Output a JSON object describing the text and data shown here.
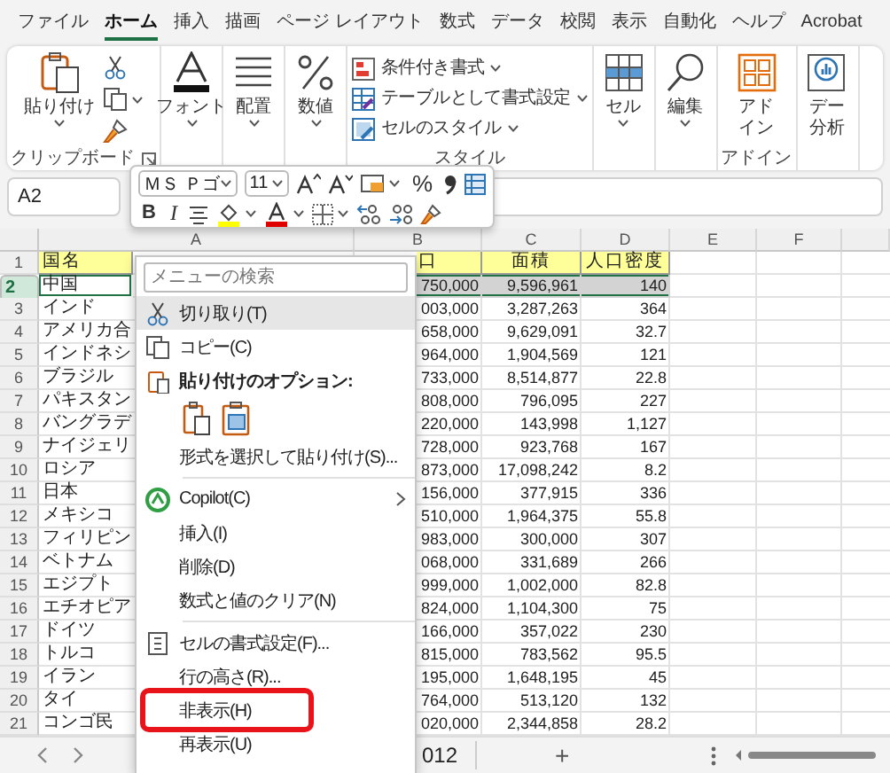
{
  "menu_tabs": [
    {
      "label": "ファイル",
      "selected": false
    },
    {
      "label": "ホーム",
      "selected": true
    },
    {
      "label": "挿入",
      "selected": false
    },
    {
      "label": "描画",
      "selected": false
    },
    {
      "label": "ページ レイアウト",
      "selected": false
    },
    {
      "label": "数式",
      "selected": false
    },
    {
      "label": "データ",
      "selected": false
    },
    {
      "label": "校閲",
      "selected": false
    },
    {
      "label": "表示",
      "selected": false
    },
    {
      "label": "自動化",
      "selected": false
    },
    {
      "label": "ヘルプ",
      "selected": false
    },
    {
      "label": "Acrobat",
      "selected": false
    }
  ],
  "ribbon_groups": [
    {
      "kind": "clipboard",
      "button": "貼り付け",
      "label": "クリップボード"
    },
    {
      "kind": "big",
      "button_lines": [
        "フォント"
      ],
      "dropdown": true
    },
    {
      "kind": "big",
      "button_lines": [
        "配置"
      ],
      "dropdown": true
    },
    {
      "kind": "big",
      "button_lines": [
        "数値"
      ],
      "dropdown": true
    },
    {
      "kind": "styles",
      "items": [
        "条件付き書式",
        "テーブルとして書式設定",
        "セルのスタイル"
      ],
      "label": "スタイル"
    },
    {
      "kind": "big",
      "button_lines": [
        "セル"
      ],
      "dropdown": true
    },
    {
      "kind": "big",
      "button_lines": [
        "編集"
      ],
      "dropdown": true
    },
    {
      "kind": "big",
      "button_lines": [
        "アド",
        "イン"
      ],
      "dropdown": false,
      "label": "アドイン"
    },
    {
      "kind": "big",
      "button_lines": [
        "デー",
        "分析"
      ],
      "dropdown": false
    }
  ],
  "formula_bar": {
    "name_box": "A2"
  },
  "mini_toolbar": {
    "font": "ＭＳ Ｐゴ",
    "size": "11",
    "percent": "%",
    "bold": "B",
    "italic": "I"
  },
  "sheet": {
    "columns": [
      "A",
      "B",
      "C",
      "D",
      "E",
      "F"
    ],
    "rows": [
      {
        "number": "1",
        "kind": "header",
        "selected": false,
        "cells": [
          "国名",
          "口",
          "面積",
          "人口密度"
        ]
      },
      {
        "number": "2",
        "kind": "data",
        "selected": true,
        "cells": [
          "中国",
          "750,000",
          "9,596,961",
          "140"
        ]
      },
      {
        "number": "3",
        "kind": "data",
        "selected": false,
        "cells": [
          "インド",
          "003,000",
          "3,287,263",
          "364"
        ]
      },
      {
        "number": "4",
        "kind": "data",
        "selected": false,
        "cells": [
          "アメリカ合",
          "658,000",
          "9,629,091",
          "32.7"
        ]
      },
      {
        "number": "5",
        "kind": "data",
        "selected": false,
        "cells": [
          "インドネシ",
          "964,000",
          "1,904,569",
          "121"
        ]
      },
      {
        "number": "6",
        "kind": "data",
        "selected": false,
        "cells": [
          "ブラジル",
          "733,000",
          "8,514,877",
          "22.8"
        ]
      },
      {
        "number": "7",
        "kind": "data",
        "selected": false,
        "cells": [
          "パキスタン",
          "808,000",
          "796,095",
          "227"
        ]
      },
      {
        "number": "8",
        "kind": "data",
        "selected": false,
        "cells": [
          "バングラデ",
          "220,000",
          "143,998",
          "1,127"
        ]
      },
      {
        "number": "9",
        "kind": "data",
        "selected": false,
        "cells": [
          "ナイジェリ",
          "728,000",
          "923,768",
          "167"
        ]
      },
      {
        "number": "10",
        "kind": "data",
        "selected": false,
        "cells": [
          "ロシア",
          "873,000",
          "17,098,242",
          "8.2"
        ]
      },
      {
        "number": "11",
        "kind": "data",
        "selected": false,
        "cells": [
          "日本",
          "156,000",
          "377,915",
          "336"
        ]
      },
      {
        "number": "12",
        "kind": "data",
        "selected": false,
        "cells": [
          "メキシコ",
          "510,000",
          "1,964,375",
          "55.8"
        ]
      },
      {
        "number": "13",
        "kind": "data",
        "selected": false,
        "cells": [
          "フィリピン",
          "983,000",
          "300,000",
          "307"
        ]
      },
      {
        "number": "14",
        "kind": "data",
        "selected": false,
        "cells": [
          "ベトナム",
          "068,000",
          "331,689",
          "266"
        ]
      },
      {
        "number": "15",
        "kind": "data",
        "selected": false,
        "cells": [
          "エジプト",
          "999,000",
          "1,002,000",
          "82.8"
        ]
      },
      {
        "number": "16",
        "kind": "data",
        "selected": false,
        "cells": [
          "エチオピア",
          "824,000",
          "1,104,300",
          "75"
        ]
      },
      {
        "number": "17",
        "kind": "data",
        "selected": false,
        "cells": [
          "ドイツ",
          "166,000",
          "357,022",
          "230"
        ]
      },
      {
        "number": "18",
        "kind": "data",
        "selected": false,
        "cells": [
          "トルコ",
          "815,000",
          "783,562",
          "95.5"
        ]
      },
      {
        "number": "19",
        "kind": "data",
        "selected": false,
        "cells": [
          "イラン",
          "195,000",
          "1,648,195",
          "45"
        ]
      },
      {
        "number": "20",
        "kind": "data",
        "selected": false,
        "cells": [
          "タイ",
          "764,000",
          "513,120",
          "132"
        ]
      },
      {
        "number": "21",
        "kind": "data",
        "selected": false,
        "cells": [
          "コンゴ民",
          "020,000",
          "2,344,858",
          "28.2"
        ]
      }
    ]
  },
  "sheet_bar": {
    "tab": "012",
    "add_button": "+"
  },
  "context_menu": {
    "search_placeholder": "メニューの検索",
    "items": [
      {
        "kind": "item",
        "label": "切り取り(T)",
        "selected": true,
        "boxed": false,
        "submenu": false
      },
      {
        "kind": "item",
        "label": "コピー(C)",
        "selected": false,
        "boxed": false,
        "submenu": false
      },
      {
        "kind": "heading",
        "label": "貼り付けのオプション:"
      },
      {
        "kind": "paste_options"
      },
      {
        "kind": "item",
        "label": "形式を選択して貼り付け(S)...",
        "selected": false,
        "boxed": false,
        "submenu": false
      },
      {
        "kind": "separator"
      },
      {
        "kind": "item",
        "label": "Copilot(C)",
        "selected": false,
        "boxed": false,
        "submenu": true
      },
      {
        "kind": "item",
        "label": "挿入(I)",
        "selected": false,
        "boxed": false,
        "submenu": false
      },
      {
        "kind": "item",
        "label": "削除(D)",
        "selected": false,
        "boxed": false,
        "submenu": false
      },
      {
        "kind": "item",
        "label": "数式と値のクリア(N)",
        "selected": false,
        "boxed": false,
        "submenu": false
      },
      {
        "kind": "separator"
      },
      {
        "kind": "item",
        "label": "セルの書式設定(F)...",
        "selected": false,
        "boxed": false,
        "submenu": false
      },
      {
        "kind": "item",
        "label": "行の高さ(R)...",
        "selected": false,
        "boxed": false,
        "submenu": false
      },
      {
        "kind": "item",
        "label": "非表示(H)",
        "selected": false,
        "boxed": true,
        "submenu": false
      },
      {
        "kind": "item",
        "label": "再表示(U)",
        "selected": false,
        "boxed": false,
        "submenu": false
      }
    ]
  }
}
